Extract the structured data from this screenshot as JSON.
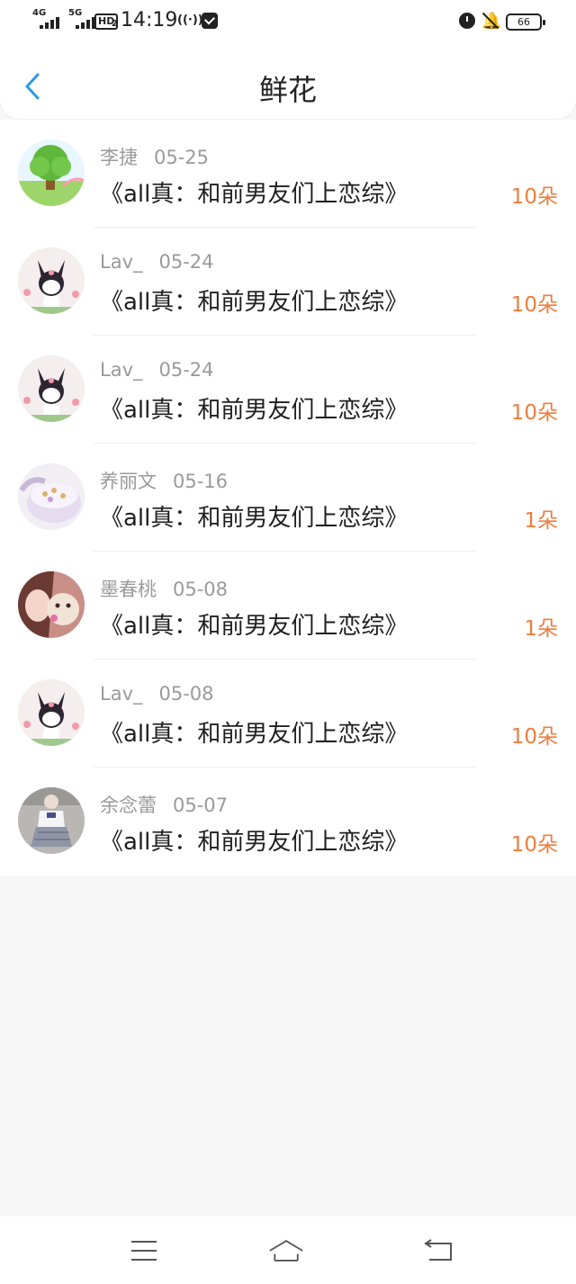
{
  "status_bar": {
    "net1": "4G",
    "net2": "5G",
    "hd": "HD",
    "hd_sub": "2",
    "time": "14:19",
    "hotspot": "((·))",
    "battery": "66"
  },
  "header": {
    "title": "鲜花",
    "back_icon": "chevron-left-icon"
  },
  "records": [
    {
      "user": "李捷",
      "date": "05-25",
      "book": "《all真：和前男友们上恋综》",
      "count": "10朵",
      "avatar": "tree-landscape"
    },
    {
      "user": "Lav_",
      "date": "05-24",
      "book": "《all真：和前男友们上恋综》",
      "count": "10朵",
      "avatar": "kuromi"
    },
    {
      "user": "Lav_",
      "date": "05-24",
      "book": "《all真：和前男友们上恋综》",
      "count": "10朵",
      "avatar": "kuromi"
    },
    {
      "user": "养丽文",
      "date": "05-16",
      "book": "《all真：和前男友们上恋综》",
      "count": "1朵",
      "avatar": "jewelry-box"
    },
    {
      "user": "墨春桃",
      "date": "05-08",
      "book": "《all真：和前男友们上恋综》",
      "count": "1朵",
      "avatar": "girl-with-puppy"
    },
    {
      "user": "Lav_",
      "date": "05-08",
      "book": "《all真：和前男友们上恋综》",
      "count": "10朵",
      "avatar": "kuromi"
    },
    {
      "user": "余念蕾",
      "date": "05-07",
      "book": "《all真：和前男友们上恋综》",
      "count": "10朵",
      "avatar": "girl-in-uniform"
    }
  ],
  "nav": {
    "menu_icon": "menu-icon",
    "home_icon": "home-icon",
    "back_icon": "back-icon"
  },
  "colors": {
    "accent_orange": "#ee7d3d",
    "back_blue": "#2a9ae6",
    "background": "#f8f7f8"
  }
}
